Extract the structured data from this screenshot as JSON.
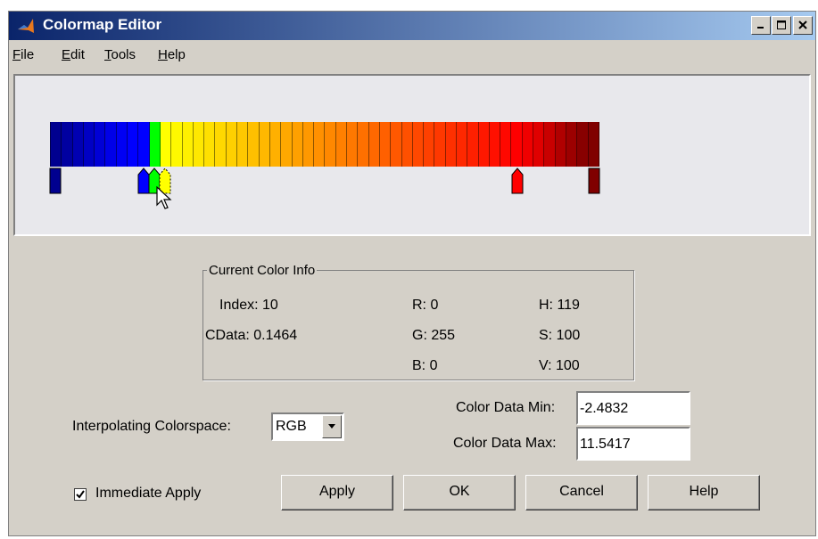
{
  "window": {
    "title": "Colormap Editor"
  },
  "menu": [
    {
      "label": "File",
      "u": "F",
      "rest": "ile"
    },
    {
      "label": "Edit",
      "u": "E",
      "rest": "dit"
    },
    {
      "label": "Tools",
      "u": "T",
      "rest": "ools"
    },
    {
      "label": "Help",
      "u": "H",
      "rest": "elp"
    }
  ],
  "colormap": {
    "colors": [
      "#00008f",
      "#0000a0",
      "#0000b2",
      "#0000c4",
      "#0000d6",
      "#0000e8",
      "#0000f4",
      "#0000ff",
      "#0000ff",
      "#00ff00",
      "#ffff00",
      "#fff800",
      "#fff000",
      "#ffe800",
      "#ffe000",
      "#ffd800",
      "#ffd000",
      "#ffc800",
      "#ffc000",
      "#ffb800",
      "#ffb000",
      "#ffa800",
      "#ffa000",
      "#ff9800",
      "#ff9000",
      "#ff8800",
      "#ff8000",
      "#ff7800",
      "#ff7000",
      "#ff6800",
      "#ff6000",
      "#ff5800",
      "#ff5000",
      "#ff4800",
      "#ff4000",
      "#ff3800",
      "#ff3000",
      "#ff2800",
      "#ff2000",
      "#ff1800",
      "#ff1000",
      "#ff0800",
      "#ff0000",
      "#f00000",
      "#e00000",
      "#c80000",
      "#b00000",
      "#9c0000",
      "#880000",
      "#800000"
    ],
    "markers": [
      {
        "index": 0,
        "type": "square",
        "color": "#00008f"
      },
      {
        "index": 8,
        "type": "arrow",
        "color": "#0000ff"
      },
      {
        "index": 9,
        "type": "arrow",
        "color": "#00ff00"
      },
      {
        "index": 10,
        "type": "arrow-dashed",
        "color": "#ffff00"
      },
      {
        "index": 42,
        "type": "arrow",
        "color": "#ff0000"
      },
      {
        "index": 49,
        "type": "square",
        "color": "#800000"
      }
    ]
  },
  "current_color_info": {
    "legend": "Current Color Info",
    "index": "Index: 10",
    "cdata": "CData: 0.1464",
    "r": "R: 0",
    "g": "G: 255",
    "b": "B: 0",
    "h": "H: 119",
    "s": "S: 100",
    "v": "V: 100"
  },
  "colorspace": {
    "label": "Interpolating Colorspace:",
    "value": "RGB"
  },
  "color_data": {
    "min_label": "Color Data Min:",
    "min_value": "-2.4832",
    "max_label": "Color Data Max:",
    "max_value": "11.5417"
  },
  "immediate_apply": {
    "label": "Immediate Apply",
    "checked": true
  },
  "buttons": {
    "apply": "Apply",
    "ok": "OK",
    "cancel": "Cancel",
    "help": "Help"
  }
}
